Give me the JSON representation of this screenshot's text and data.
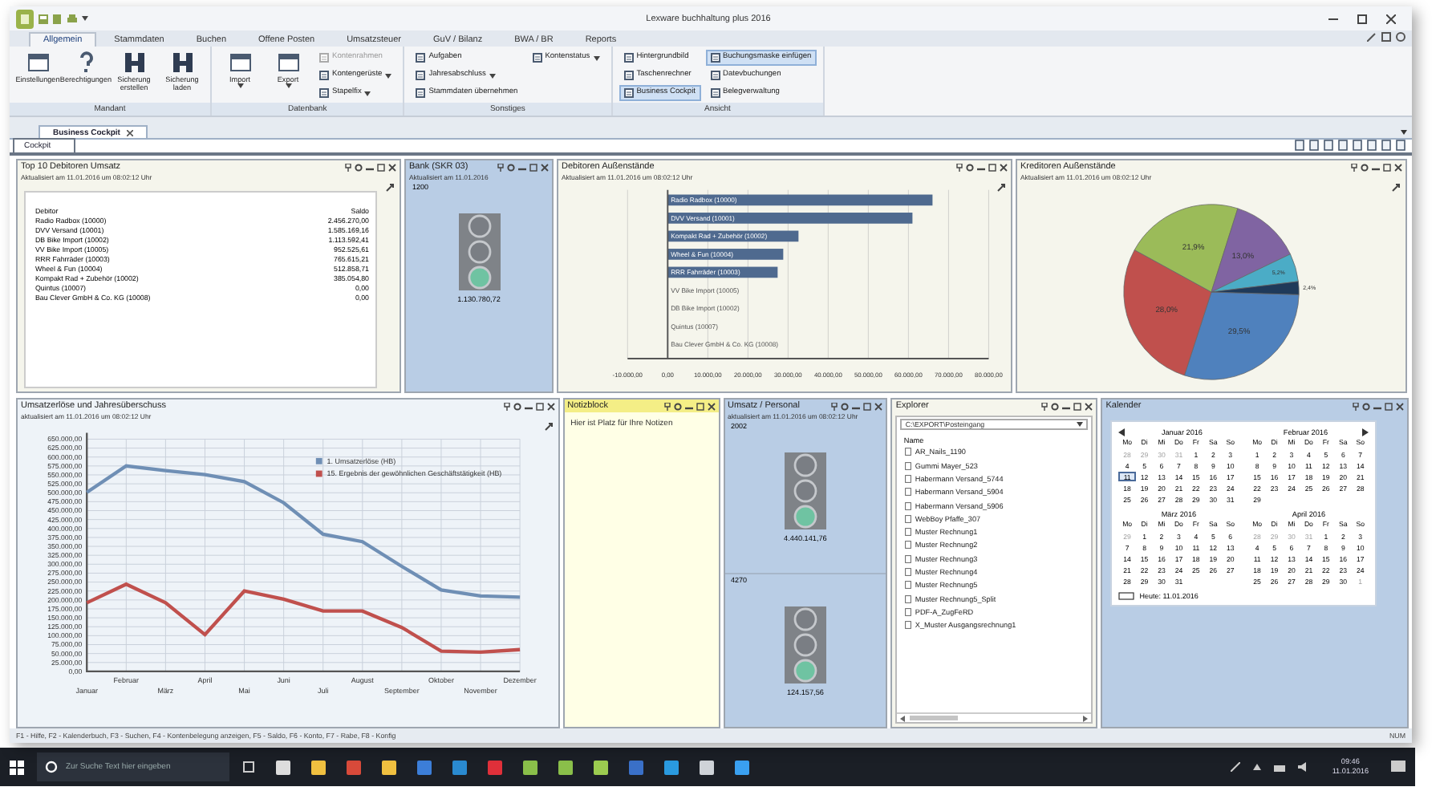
{
  "window": {
    "title": "Lexware buchhaltung plus 2016"
  },
  "ribbon": {
    "tabs": [
      {
        "label": "Allgemein",
        "selected": true
      },
      {
        "label": "Stammdaten",
        "selected": false
      },
      {
        "label": "Buchen",
        "selected": false
      },
      {
        "label": "Offene Posten",
        "selected": false
      },
      {
        "label": "Umsatzsteuer",
        "selected": false
      },
      {
        "label": "GuV / Bilanz",
        "selected": false
      },
      {
        "label": "BWA / BR",
        "selected": false
      },
      {
        "label": "Reports",
        "selected": false
      }
    ],
    "groups": [
      {
        "label": "Mandant",
        "items": [
          {
            "kind": "large",
            "label": "Einstellungen",
            "dropdown": false
          },
          {
            "kind": "large",
            "label": "Berechtigungen",
            "dropdown": false
          },
          {
            "kind": "large",
            "label": "Sicherung erstellen",
            "dropdown": false
          },
          {
            "kind": "large",
            "label": "Sicherung laden",
            "dropdown": false
          }
        ]
      },
      {
        "label": "Datenbank",
        "items": [
          {
            "kind": "large",
            "label": "Import",
            "dropdown": true
          },
          {
            "kind": "large",
            "label": "Export",
            "dropdown": true
          },
          {
            "kind": "small",
            "label": "Kontenrahmen",
            "dropdown": false,
            "disabled": true
          },
          {
            "kind": "small",
            "label": "Kontengerüste",
            "dropdown": true,
            "disabled": false
          },
          {
            "kind": "small",
            "label": "Stapelfix",
            "dropdown": true,
            "disabled": false
          }
        ]
      },
      {
        "label": "Sonstiges",
        "items": [
          {
            "kind": "small",
            "label": "Aufgaben",
            "dropdown": false
          },
          {
            "kind": "small",
            "label": "Jahresabschluss",
            "dropdown": true
          },
          {
            "kind": "small",
            "label": "Stammdaten übernehmen",
            "dropdown": false
          },
          {
            "kind": "small",
            "label": "Kontenstatus",
            "dropdown": true
          }
        ]
      },
      {
        "label": "Ansicht",
        "items": [
          {
            "kind": "small",
            "label": "Hintergrundbild",
            "dropdown": false,
            "selected": false
          },
          {
            "kind": "small",
            "label": "Taschenrechner",
            "dropdown": false,
            "selected": false
          },
          {
            "kind": "small",
            "label": "Business Cockpit",
            "dropdown": false,
            "selected": true
          },
          {
            "kind": "small",
            "label": "Buchungsmaske einfügen",
            "dropdown": false,
            "selected": true
          },
          {
            "kind": "small",
            "label": "Datevbuchungen",
            "dropdown": false,
            "selected": false
          },
          {
            "kind": "small",
            "label": "Belegverwaltung",
            "dropdown": false,
            "selected": false
          }
        ]
      }
    ]
  },
  "document_tabs": [
    {
      "label": "Business Cockpit",
      "selected": true
    }
  ],
  "cockpit_tabs": [
    {
      "label": "Cockpit",
      "selected": true
    }
  ],
  "cockpit": {
    "row_1": [
      {
        "kind": "table",
        "title": "Top 10 Debitoren Umsatz",
        "subtitle": "Aktualisiert am 11.01.2016 um 08:02:12 Uhr",
        "columns": [
          "Debitor",
          "Saldo"
        ],
        "rows": [
          [
            "Radio Radbox (10000)",
            "2.456.270,00"
          ],
          [
            "DVV Versand (10001)",
            "1.585.169,16"
          ],
          [
            "DB Bike Import (10002)",
            "1.113.592,41"
          ],
          [
            "VV Bike Import (10005)",
            "952.525,61"
          ],
          [
            "RRR Fahrräder (10003)",
            "765.615,21"
          ],
          [
            "Wheel & Fun (10004)",
            "512.858,71"
          ],
          [
            "Kompakt Rad + Zubehör (10002)",
            "385.054,80"
          ],
          [
            "Quintus (10007)",
            "0,00"
          ],
          [
            "Bau Clever GmbH & Co. KG (10008)",
            "0,00"
          ]
        ]
      },
      {
        "kind": "traffic",
        "title": "Bank (SKR 03)",
        "subtitle": "Aktualisiert am 11.01.2016",
        "sections": [
          {
            "label": "1200",
            "status_ok": true,
            "reading": "1.130.780,72"
          }
        ]
      },
      {
        "kind": "bars",
        "title": "Debitoren Außenstände",
        "subtitle": "Aktualisiert am 11.01.2016 um 08:02:12 Uhr",
        "chart_data": {
          "type": "bar",
          "orientation": "horizontal",
          "categories": [
            "Radio Radbox (10000)",
            "DVV Versand (10001)",
            "Kompakt Rad + Zubehör (10002)",
            "Wheel & Fun (10004)",
            "RRR Fahrräder (10003)",
            "VV Bike Import (10005)",
            "DB Bike Import (10002)",
            "Quintus (10007)",
            "Bau Clever GmbH & Co. KG (10008)"
          ],
          "series": [
            {
              "color": "#4f6a8f",
              "values": [
                66000,
                61000,
                32600,
                28800,
                27400,
                0,
                0,
                0,
                0
              ]
            }
          ],
          "grid": true,
          "xlim": [
            -10000,
            80000
          ],
          "xticks": [
            {
              "value": -10000,
              "label": "-10.000,00"
            },
            {
              "value": 0,
              "label": "0,00"
            },
            {
              "value": 10000,
              "label": "10.000,00"
            },
            {
              "value": 20000,
              "label": "20.000,00"
            },
            {
              "value": 30000,
              "label": "30.000,00"
            },
            {
              "value": 40000,
              "label": "40.000,00"
            },
            {
              "value": 50000,
              "label": "50.000,00"
            },
            {
              "value": 60000,
              "label": "60.000,00"
            },
            {
              "value": 70000,
              "label": "70.000,00"
            },
            {
              "value": 80000,
              "label": "80.000,00"
            }
          ]
        }
      },
      {
        "kind": "pie",
        "title": "Kreditoren Außenstände",
        "subtitle": "Aktualisiert am 11.01.2016 um 08:02:12 Uhr",
        "chart_data": {
          "type": "pie",
          "values": [
            29.5,
            28.0,
            21.9,
            13.0,
            5.2,
            2.4
          ],
          "colors": [
            "#4f81bd",
            "#c0504d",
            "#9bbb59",
            "#8064a2",
            "#4bacc6",
            "#1f3a5a"
          ],
          "value_labels": [
            "29,5%",
            "28,0%",
            "21,9%",
            "13,0%",
            "5,2%",
            "2,4%"
          ]
        }
      }
    ],
    "row_2": [
      {
        "kind": "lines",
        "title": "Umsatzerlöse und Jahresüberschuss",
        "subtitle": "aktualisiert am 11.01.2016 um 08:02:12 Uhr",
        "chart_data": {
          "type": "line",
          "x": [
            "Januar",
            "Februar",
            "März",
            "April",
            "Mai",
            "Juni",
            "Juli",
            "August",
            "September",
            "Oktober",
            "November",
            "Dezember"
          ],
          "series": [
            {
              "name": "1. Umsatzerlöse (HB)",
              "color": "#6f8fb5",
              "values": [
                501000,
                575000,
                562000,
                551000,
                531000,
                472000,
                384000,
                363000,
                294000,
                228000,
                211000,
                208000
              ]
            },
            {
              "name": "15. Ergebnis der gewöhnlichen Geschäftstätigkeit (HB)",
              "color": "#c0504d",
              "values": [
                192000,
                244000,
                192000,
                103000,
                225000,
                202000,
                169000,
                169000,
                123000,
                57000,
                54000,
                61000
              ]
            }
          ],
          "grid": true,
          "legend": "top-right",
          "ylim": [
            0,
            650000
          ],
          "yticks": [
            {
              "value": 0,
              "label": "0,00"
            },
            {
              "value": 25000,
              "label": "25.000,00"
            },
            {
              "value": 50000,
              "label": "50.000,00"
            },
            {
              "value": 75000,
              "label": "75.000,00"
            },
            {
              "value": 100000,
              "label": "100.000,00"
            },
            {
              "value": 125000,
              "label": "125.000,00"
            },
            {
              "value": 150000,
              "label": "150.000,00"
            },
            {
              "value": 175000,
              "label": "175.000,00"
            },
            {
              "value": 200000,
              "label": "200.000,00"
            },
            {
              "value": 225000,
              "label": "225.000,00"
            },
            {
              "value": 250000,
              "label": "250.000,00"
            },
            {
              "value": 275000,
              "label": "275.000,00"
            },
            {
              "value": 300000,
              "label": "300.000,00"
            },
            {
              "value": 325000,
              "label": "325.000,00"
            },
            {
              "value": 350000,
              "label": "350.000,00"
            },
            {
              "value": 375000,
              "label": "375.000,00"
            },
            {
              "value": 400000,
              "label": "400.000,00"
            },
            {
              "value": 425000,
              "label": "425.000,00"
            },
            {
              "value": 450000,
              "label": "450.000,00"
            },
            {
              "value": 475000,
              "label": "475.000,00"
            },
            {
              "value": 500000,
              "label": "500.000,00"
            },
            {
              "value": 525000,
              "label": "525.000,00"
            },
            {
              "value": 550000,
              "label": "550.000,00"
            },
            {
              "value": 575000,
              "label": "575.000,00"
            },
            {
              "value": 600000,
              "label": "600.000,00"
            },
            {
              "value": 625000,
              "label": "625.000,00"
            },
            {
              "value": 650000,
              "label": "650.000,00"
            }
          ]
        }
      },
      {
        "kind": "notes",
        "title": "Notizblock",
        "text": "Hier ist Platz für Ihre Notizen"
      },
      {
        "kind": "traffic",
        "title": "Umsatz / Personal",
        "subtitle": "aktualisiert am 11.01.2016 um 08:02:12 Uhr",
        "sections": [
          {
            "label": "2002",
            "status_ok": true,
            "reading": "4.440.141,76"
          },
          {
            "label": "4270",
            "status_ok": true,
            "reading": "124.157,56"
          }
        ]
      },
      {
        "kind": "explorer",
        "title": "Explorer",
        "path": "C:\\EXPORT\\Posteingang",
        "column": "Name",
        "files": [
          "AR_Nails_1190",
          "Gummi Mayer_523",
          "Habermann Versand_5744",
          "Habermann Versand_5904",
          "Habermann Versand_5906",
          "WebBoy Pfaffe_307",
          "Muster Rechnung1",
          "Muster Rechnung2",
          "Muster Rechnung3",
          "Muster Rechnung4",
          "Muster Rechnung5",
          "Muster Rechnung5_Split",
          "PDF-A_ZugFeRD",
          "X_Muster Ausgangsrechnung1"
        ]
      },
      {
        "kind": "calendar",
        "title": "Kalender",
        "today": "Heute: 11.01.2016",
        "months": [
          {
            "title": "Januar 2016",
            "weekdays": [
              "Mo",
              "Di",
              "Mi",
              "Do",
              "Fr",
              "Sa",
              "So"
            ],
            "weeks": [
              [
                {
                  "d": "28",
                  "other": true,
                  "today": false
                },
                {
                  "d": "29",
                  "other": true,
                  "today": false
                },
                {
                  "d": "30",
                  "other": true,
                  "today": false
                },
                {
                  "d": "31",
                  "other": true,
                  "today": false
                },
                {
                  "d": "1",
                  "other": false,
                  "today": false
                },
                {
                  "d": "2",
                  "other": false,
                  "today": false
                },
                {
                  "d": "3",
                  "other": false,
                  "today": false
                }
              ],
              [
                {
                  "d": "4",
                  "other": false,
                  "today": false
                },
                {
                  "d": "5",
                  "other": false,
                  "today": false
                },
                {
                  "d": "6",
                  "other": false,
                  "today": false
                },
                {
                  "d": "7",
                  "other": false,
                  "today": false
                },
                {
                  "d": "8",
                  "other": false,
                  "today": false
                },
                {
                  "d": "9",
                  "other": false,
                  "today": false
                },
                {
                  "d": "10",
                  "other": false,
                  "today": false
                }
              ],
              [
                {
                  "d": "11",
                  "other": false,
                  "today": true
                },
                {
                  "d": "12",
                  "other": false,
                  "today": false
                },
                {
                  "d": "13",
                  "other": false,
                  "today": false
                },
                {
                  "d": "14",
                  "other": false,
                  "today": false
                },
                {
                  "d": "15",
                  "other": false,
                  "today": false
                },
                {
                  "d": "16",
                  "other": false,
                  "today": false
                },
                {
                  "d": "17",
                  "other": false,
                  "today": false
                }
              ],
              [
                {
                  "d": "18",
                  "other": false,
                  "today": false
                },
                {
                  "d": "19",
                  "other": false,
                  "today": false
                },
                {
                  "d": "20",
                  "other": false,
                  "today": false
                },
                {
                  "d": "21",
                  "other": false,
                  "today": false
                },
                {
                  "d": "22",
                  "other": false,
                  "today": false
                },
                {
                  "d": "23",
                  "other": false,
                  "today": false
                },
                {
                  "d": "24",
                  "other": false,
                  "today": false
                }
              ],
              [
                {
                  "d": "25",
                  "other": false,
                  "today": false
                },
                {
                  "d": "26",
                  "other": false,
                  "today": false
                },
                {
                  "d": "27",
                  "other": false,
                  "today": false
                },
                {
                  "d": "28",
                  "other": false,
                  "today": false
                },
                {
                  "d": "29",
                  "other": false,
                  "today": false
                },
                {
                  "d": "30",
                  "other": false,
                  "today": false
                },
                {
                  "d": "31",
                  "other": false,
                  "today": false
                }
              ]
            ]
          },
          {
            "title": "Februar 2016",
            "weekdays": [
              "Mo",
              "Di",
              "Mi",
              "Do",
              "Fr",
              "Sa",
              "So"
            ],
            "weeks": [
              [
                {
                  "d": "1",
                  "other": false,
                  "today": false
                },
                {
                  "d": "2",
                  "other": false,
                  "today": false
                },
                {
                  "d": "3",
                  "other": false,
                  "today": false
                },
                {
                  "d": "4",
                  "other": false,
                  "today": false
                },
                {
                  "d": "5",
                  "other": false,
                  "today": false
                },
                {
                  "d": "6",
                  "other": false,
                  "today": false
                },
                {
                  "d": "7",
                  "other": false,
                  "today": false
                }
              ],
              [
                {
                  "d": "8",
                  "other": false,
                  "today": false
                },
                {
                  "d": "9",
                  "other": false,
                  "today": false
                },
                {
                  "d": "10",
                  "other": false,
                  "today": false
                },
                {
                  "d": "11",
                  "other": false,
                  "today": false
                },
                {
                  "d": "12",
                  "other": false,
                  "today": false
                },
                {
                  "d": "13",
                  "other": false,
                  "today": false
                },
                {
                  "d": "14",
                  "other": false,
                  "today": false
                }
              ],
              [
                {
                  "d": "15",
                  "other": false,
                  "today": false
                },
                {
                  "d": "16",
                  "other": false,
                  "today": false
                },
                {
                  "d": "17",
                  "other": false,
                  "today": false
                },
                {
                  "d": "18",
                  "other": false,
                  "today": false
                },
                {
                  "d": "19",
                  "other": false,
                  "today": false
                },
                {
                  "d": "20",
                  "other": false,
                  "today": false
                },
                {
                  "d": "21",
                  "other": false,
                  "today": false
                }
              ],
              [
                {
                  "d": "22",
                  "other": false,
                  "today": false
                },
                {
                  "d": "23",
                  "other": false,
                  "today": false
                },
                {
                  "d": "24",
                  "other": false,
                  "today": false
                },
                {
                  "d": "25",
                  "other": false,
                  "today": false
                },
                {
                  "d": "26",
                  "other": false,
                  "today": false
                },
                {
                  "d": "27",
                  "other": false,
                  "today": false
                },
                {
                  "d": "28",
                  "other": false,
                  "today": false
                }
              ],
              [
                {
                  "d": "29",
                  "other": false,
                  "today": false
                }
              ]
            ]
          },
          {
            "title": "März 2016",
            "weekdays": [
              "Mo",
              "Di",
              "Mi",
              "Do",
              "Fr",
              "Sa",
              "So"
            ],
            "weeks": [
              [
                {
                  "d": "29",
                  "other": true,
                  "today": false
                },
                {
                  "d": "1",
                  "other": false,
                  "today": false
                },
                {
                  "d": "2",
                  "other": false,
                  "today": false
                },
                {
                  "d": "3",
                  "other": false,
                  "today": false
                },
                {
                  "d": "4",
                  "other": false,
                  "today": false
                },
                {
                  "d": "5",
                  "other": false,
                  "today": false
                },
                {
                  "d": "6",
                  "other": false,
                  "today": false
                }
              ],
              [
                {
                  "d": "7",
                  "other": false,
                  "today": false
                },
                {
                  "d": "8",
                  "other": false,
                  "today": false
                },
                {
                  "d": "9",
                  "other": false,
                  "today": false
                },
                {
                  "d": "10",
                  "other": false,
                  "today": false
                },
                {
                  "d": "11",
                  "other": false,
                  "today": false
                },
                {
                  "d": "12",
                  "other": false,
                  "today": false
                },
                {
                  "d": "13",
                  "other": false,
                  "today": false
                }
              ],
              [
                {
                  "d": "14",
                  "other": false,
                  "today": false
                },
                {
                  "d": "15",
                  "other": false,
                  "today": false
                },
                {
                  "d": "16",
                  "other": false,
                  "today": false
                },
                {
                  "d": "17",
                  "other": false,
                  "today": false
                },
                {
                  "d": "18",
                  "other": false,
                  "today": false
                },
                {
                  "d": "19",
                  "other": false,
                  "today": false
                },
                {
                  "d": "20",
                  "other": false,
                  "today": false
                }
              ],
              [
                {
                  "d": "21",
                  "other": false,
                  "today": false
                },
                {
                  "d": "22",
                  "other": false,
                  "today": false
                },
                {
                  "d": "23",
                  "other": false,
                  "today": false
                },
                {
                  "d": "24",
                  "other": false,
                  "today": false
                },
                {
                  "d": "25",
                  "other": false,
                  "today": false
                },
                {
                  "d": "26",
                  "other": false,
                  "today": false
                },
                {
                  "d": "27",
                  "other": false,
                  "today": false
                }
              ],
              [
                {
                  "d": "28",
                  "other": false,
                  "today": false
                },
                {
                  "d": "29",
                  "other": false,
                  "today": false
                },
                {
                  "d": "30",
                  "other": false,
                  "today": false
                },
                {
                  "d": "31",
                  "other": false,
                  "today": false
                }
              ]
            ]
          },
          {
            "title": "April 2016",
            "weekdays": [
              "Mo",
              "Di",
              "Mi",
              "Do",
              "Fr",
              "Sa",
              "So"
            ],
            "weeks": [
              [
                {
                  "d": "28",
                  "other": true,
                  "today": false
                },
                {
                  "d": "29",
                  "other": true,
                  "today": false
                },
                {
                  "d": "30",
                  "other": true,
                  "today": false
                },
                {
                  "d": "31",
                  "other": true,
                  "today": false
                },
                {
                  "d": "1",
                  "other": false,
                  "today": false
                },
                {
                  "d": "2",
                  "other": false,
                  "today": false
                },
                {
                  "d": "3",
                  "other": false,
                  "today": false
                }
              ],
              [
                {
                  "d": "4",
                  "other": false,
                  "today": false
                },
                {
                  "d": "5",
                  "other": false,
                  "today": false
                },
                {
                  "d": "6",
                  "other": false,
                  "today": false
                },
                {
                  "d": "7",
                  "other": false,
                  "today": false
                },
                {
                  "d": "8",
                  "other": false,
                  "today": false
                },
                {
                  "d": "9",
                  "other": false,
                  "today": false
                },
                {
                  "d": "10",
                  "other": false,
                  "today": false
                }
              ],
              [
                {
                  "d": "11",
                  "other": false,
                  "today": false
                },
                {
                  "d": "12",
                  "other": false,
                  "today": false
                },
                {
                  "d": "13",
                  "other": false,
                  "today": false
                },
                {
                  "d": "14",
                  "other": false,
                  "today": false
                },
                {
                  "d": "15",
                  "other": false,
                  "today": false
                },
                {
                  "d": "16",
                  "other": false,
                  "today": false
                },
                {
                  "d": "17",
                  "other": false,
                  "today": false
                }
              ],
              [
                {
                  "d": "18",
                  "other": false,
                  "today": false
                },
                {
                  "d": "19",
                  "other": false,
                  "today": false
                },
                {
                  "d": "20",
                  "other": false,
                  "today": false
                },
                {
                  "d": "21",
                  "other": false,
                  "today": false
                },
                {
                  "d": "22",
                  "other": false,
                  "today": false
                },
                {
                  "d": "23",
                  "other": false,
                  "today": false
                },
                {
                  "d": "24",
                  "other": false,
                  "today": false
                }
              ],
              [
                {
                  "d": "25",
                  "other": false,
                  "today": false
                },
                {
                  "d": "26",
                  "other": false,
                  "today": false
                },
                {
                  "d": "27",
                  "other": false,
                  "today": false
                },
                {
                  "d": "28",
                  "other": false,
                  "today": false
                },
                {
                  "d": "29",
                  "other": false,
                  "today": false
                },
                {
                  "d": "30",
                  "other": false,
                  "today": false
                },
                {
                  "d": "1",
                  "other": true,
                  "today": false
                }
              ]
            ]
          }
        ]
      }
    ]
  },
  "status_bar": {
    "text": "F1 - Hilfe, F2 - Kalenderbuch, F3 - Suchen, F4 - Kontenbelegung anzeigen, F5 - Saldo, F6 - Konto, F7 - Rabe, F8 - Konfig",
    "indicator": "NUM"
  },
  "taskbar": {
    "search_placeholder": "Zur Suche Text hier eingeben",
    "time": "09:46",
    "date": "11.01.2016"
  }
}
